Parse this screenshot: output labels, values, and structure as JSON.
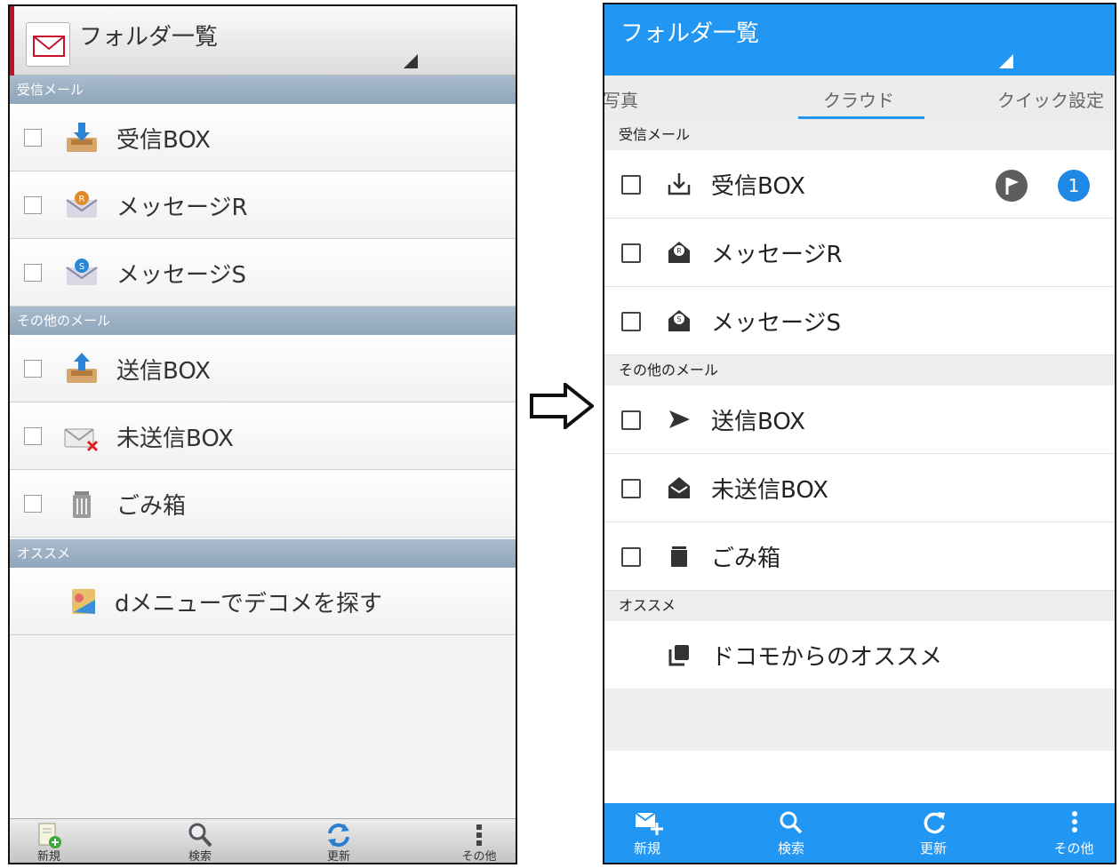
{
  "left_screen": {
    "title": "フォルダ一覧",
    "sections": [
      {
        "label": "受信メール"
      },
      {
        "label": "その他のメール"
      },
      {
        "label": "オススメ"
      }
    ],
    "inbox_items": [
      {
        "label": "受信BOX"
      },
      {
        "label": "メッセージR"
      },
      {
        "label": "メッセージS"
      }
    ],
    "other_items": [
      {
        "label": "送信BOX"
      },
      {
        "label": "未送信BOX"
      },
      {
        "label": "ごみ箱"
      }
    ],
    "recommend_item": {
      "label": "dメニューでデコメを探す"
    },
    "toolbar": [
      {
        "label": "新規",
        "icon": "new-mail-icon"
      },
      {
        "label": "検索",
        "icon": "search-icon"
      },
      {
        "label": "更新",
        "icon": "refresh-icon"
      },
      {
        "label": "その他",
        "icon": "more-vertical-icon"
      }
    ]
  },
  "right_screen": {
    "title": "フォルダ一覧",
    "accent_color": "#2196f3",
    "tabs": [
      {
        "label": "写真"
      },
      {
        "label": "クラウド",
        "active": true
      },
      {
        "label": "クイック設定"
      }
    ],
    "sections": [
      {
        "label": "受信メール"
      },
      {
        "label": "その他のメール"
      },
      {
        "label": "オススメ"
      }
    ],
    "inbox_items": [
      {
        "label": "受信BOX",
        "unread_count": "1"
      },
      {
        "label": "メッセージR"
      },
      {
        "label": "メッセージS"
      }
    ],
    "other_items": [
      {
        "label": "送信BOX"
      },
      {
        "label": "未送信BOX"
      },
      {
        "label": "ごみ箱"
      }
    ],
    "recommend_item": {
      "label": "ドコモからのオススメ"
    },
    "toolbar": [
      {
        "label": "新規",
        "icon": "new-mail-icon"
      },
      {
        "label": "検索",
        "icon": "search-icon"
      },
      {
        "label": "更新",
        "icon": "refresh-icon"
      },
      {
        "label": "その他",
        "icon": "more-vertical-icon"
      }
    ]
  }
}
